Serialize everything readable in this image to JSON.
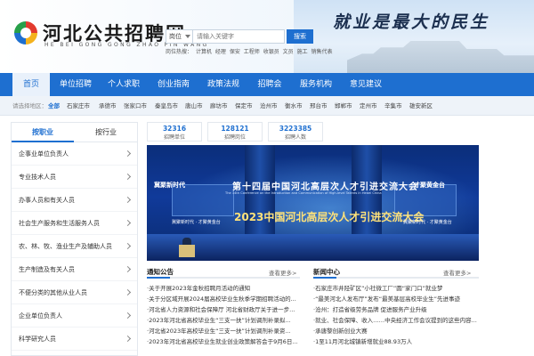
{
  "header": {
    "site_name": "河北公共招聘网",
    "site_pinyin": "HE BEI GONG GONG ZHAO PIN WANG",
    "slogan": "就业是最大的民生",
    "search": {
      "select_value": "岗位",
      "placeholder": "请输入关键字",
      "button": "搜索"
    },
    "hot_label": "岗位热搜：",
    "hot_words": [
      "计算机",
      "经理",
      "保安",
      "工程师",
      "收银员",
      "文员",
      "施工",
      "销售代表"
    ]
  },
  "nav": {
    "items": [
      "首页",
      "单位招聘",
      "个人求职",
      "创业指南",
      "政策法规",
      "招聘会",
      "服务机构",
      "意见建议"
    ],
    "active_index": 0
  },
  "region": {
    "label": "请选择地区：",
    "items": [
      "全部",
      "石家庄市",
      "承德市",
      "张家口市",
      "秦皇岛市",
      "唐山市",
      "廊坊市",
      "保定市",
      "沧州市",
      "衡水市",
      "邢台市",
      "邯郸市",
      "定州市",
      "辛集市",
      "雄安新区"
    ],
    "active_index": 0
  },
  "sidebar": {
    "tabs": [
      "按职业",
      "按行业"
    ],
    "active_tab": 0,
    "categories": [
      "企事业单位负责人",
      "专业技术人员",
      "办事人员和有关人员",
      "社会生产服务和生活服务人员",
      "农、林、牧、渔业生产及辅助人员",
      "生产制造及有关人员",
      "不便分类的其他从业人员",
      "企业单位负责人",
      "科学研究人员"
    ]
  },
  "stats": [
    {
      "value": "32316",
      "label": "招聘单位"
    },
    {
      "value": "128121",
      "label": "招聘岗位"
    },
    {
      "value": "3223385",
      "label": "招聘人数"
    }
  ],
  "banner": {
    "title": "第十四届中国河北高层次人才引进交流大会",
    "subtitle": "The 14th Conference on the Introduction and Communication of High-level Talents in Hebei China",
    "headline": "2023中国河北高层次人才引进交流大会",
    "left_tag": "冀聚新时代",
    "right_tag": "才聚黄金台",
    "left_small": "冀聚新时代 · 才聚黄金台",
    "right_small": "冀聚新时代 · 才聚黄金台"
  },
  "notices": {
    "title": "通知公告",
    "more": "查看更多>",
    "items": [
      "·关于开展2023年金秋招聘月活动的通知",
      "·关于分区域开展2024届高校毕业生秋季学期招聘活动的...",
      "·河北省人力资源和社会保障厅 河北省财政厅关于进一步...",
      "·2023年河北省高校毕业生“三支一扶”计划调剂补录拟...",
      "·河北省2023年高校毕业生“三支一扶”计划调剂补录资...",
      "·2023年河北省高校毕业生就业创业政策解答会于9月6日..."
    ]
  },
  "news": {
    "title": "新闻中心",
    "more": "查看更多>",
    "items": [
      "·石家庄市井陉矿区“小社微工厂”圆“家门口”就业梦",
      "·“最美河北人发布厅”发布“最美基层高校毕业生”先进事迹",
      "·沧州：打造省级劳务品牌 促进服务产业升级",
      "·就业、社会保障、收入……中央经济工作会议提到的这些内容...",
      "·承唐黎创新创业大赛",
      "·1至11月河北城镇新增就业88.93万人"
    ]
  },
  "colors": {
    "primary": "#1e6fd0",
    "nav_active_bg": "#e9f1fb",
    "region_bg": "#eef3f9"
  }
}
